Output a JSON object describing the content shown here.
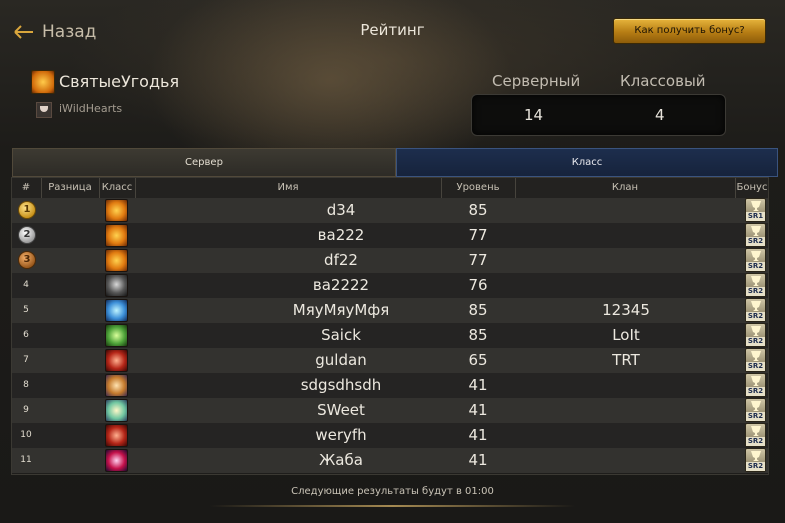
{
  "header": {
    "back_label": "Назад",
    "title": "Рейтинг",
    "bonus_button": "Как получить бонус?"
  },
  "profile": {
    "guild_name": "СвятыеУгодья",
    "subtitle": "iWildHearts"
  },
  "stats": {
    "server_label": "Серверный",
    "class_label": "Классовый",
    "server_value": "14",
    "class_value": "4"
  },
  "tabs": [
    {
      "label": "Сервер",
      "active": false
    },
    {
      "label": "Класс",
      "active": true
    }
  ],
  "table": {
    "columns": [
      "#",
      "Разница",
      "Класс",
      "Имя",
      "Уровень",
      "Клан",
      "Бонус"
    ],
    "rows": [
      {
        "rank": "1",
        "medal": "gold",
        "class_icon": "fire-class-icon",
        "name": "d34",
        "level": "85",
        "clan": "",
        "bonus": "SR1"
      },
      {
        "rank": "2",
        "medal": "silver",
        "class_icon": "fire-class-icon",
        "name": "ва222",
        "level": "77",
        "clan": "",
        "bonus": "SR2"
      },
      {
        "rank": "3",
        "medal": "bronze",
        "class_icon": "fire-class-icon",
        "name": "df22",
        "level": "77",
        "clan": "",
        "bonus": "SR2"
      },
      {
        "rank": "4",
        "medal": "",
        "class_icon": "shadow-class-icon",
        "name": "ва2222",
        "level": "76",
        "clan": "",
        "bonus": "SR2"
      },
      {
        "rank": "5",
        "medal": "",
        "class_icon": "frost-class-icon",
        "name": "МяуМяуМфя",
        "level": "85",
        "clan": "12345",
        "bonus": "SR2"
      },
      {
        "rank": "6",
        "medal": "",
        "class_icon": "nature-class-icon",
        "name": "Saick",
        "level": "85",
        "clan": "LoIt",
        "bonus": "SR2"
      },
      {
        "rank": "7",
        "medal": "",
        "class_icon": "blood-class-icon",
        "name": "guldan",
        "level": "65",
        "clan": "TRT",
        "bonus": "SR2"
      },
      {
        "rank": "8",
        "medal": "",
        "class_icon": "warrior-class-icon",
        "name": "sdgsdhsdh",
        "level": "41",
        "clan": "",
        "bonus": "SR2"
      },
      {
        "rank": "9",
        "medal": "",
        "class_icon": "spirit-class-icon",
        "name": "SWeet",
        "level": "41",
        "clan": "",
        "bonus": "SR2"
      },
      {
        "rank": "10",
        "medal": "",
        "class_icon": "blood-class-icon",
        "name": "weryfh",
        "level": "41",
        "clan": "",
        "bonus": "SR2"
      },
      {
        "rank": "11",
        "medal": "",
        "class_icon": "chaos-class-icon",
        "name": "Жаба",
        "level": "41",
        "clan": "",
        "bonus": "SR2"
      }
    ]
  },
  "footer": {
    "text": "Следующие результаты будут в 01:00"
  },
  "colors": {
    "accent_gold": "#c9931c",
    "tab_active": "#1d2e4d",
    "row_odd": "#33322f",
    "row_even": "#252423"
  }
}
